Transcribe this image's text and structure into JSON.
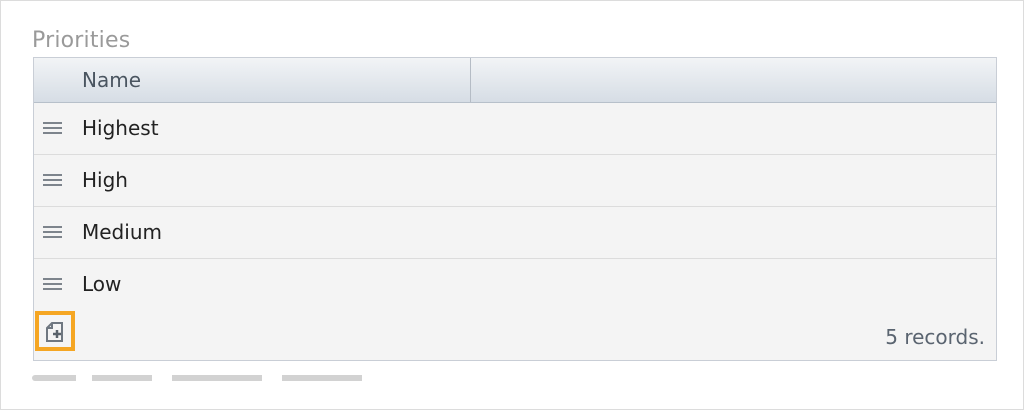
{
  "section": {
    "title": "Priorities"
  },
  "grid": {
    "columns": [
      "Name",
      ""
    ],
    "rows": [
      {
        "name": "Highest"
      },
      {
        "name": "High"
      },
      {
        "name": "Medium"
      },
      {
        "name": "Low"
      }
    ]
  },
  "footer": {
    "records_text": "5 records."
  },
  "colors": {
    "add_button_highlight": "#f5a623",
    "header_bg": "#dfe5eb"
  },
  "icons": {
    "row_drag": "drag-handle-icon",
    "add": "add-document-icon"
  }
}
